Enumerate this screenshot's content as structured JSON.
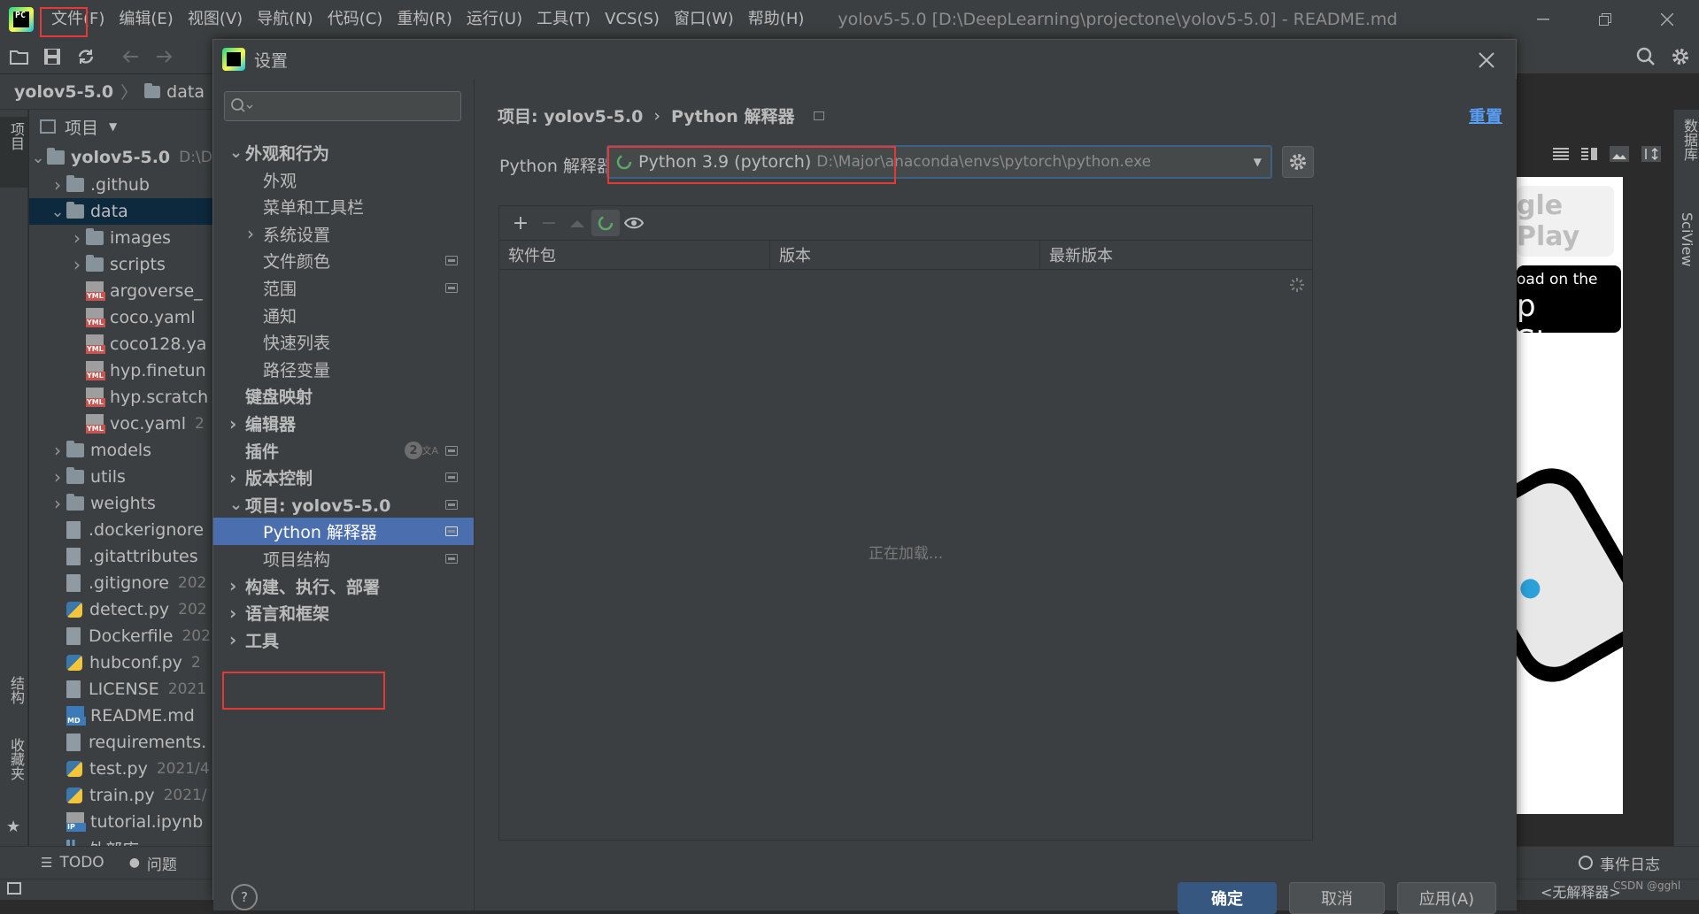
{
  "app": {
    "window_title": "yolov5-5.0 [D:\\DeepLearning\\projectone\\yolov5-5.0] - README.md",
    "logo_text": "PC"
  },
  "menubar": {
    "items": [
      {
        "label": "文件(F)"
      },
      {
        "label": "编辑(E)"
      },
      {
        "label": "视图(V)"
      },
      {
        "label": "导航(N)"
      },
      {
        "label": "代码(C)"
      },
      {
        "label": "重构(R)"
      },
      {
        "label": "运行(U)"
      },
      {
        "label": "工具(T)"
      },
      {
        "label": "VCS(S)"
      },
      {
        "label": "窗口(W)"
      },
      {
        "label": "帮助(H)"
      }
    ]
  },
  "breadcrumb": {
    "project": "yolov5-5.0",
    "folder": "data"
  },
  "left_stripe": {
    "project_tab": "项目",
    "structure_tab": "结构",
    "favorites_tab": "收藏夹"
  },
  "right_stripe": {
    "database_tab": "数据库",
    "sciview_tab": "SciView"
  },
  "project_panel": {
    "title": "项目",
    "tree": [
      {
        "name": "yolov5-5.0",
        "extra": "D:\\D",
        "type": "folder",
        "expanded": true,
        "bold": true
      },
      {
        "name": ".github",
        "extra": "",
        "type": "folder"
      },
      {
        "name": "data",
        "extra": "",
        "type": "folder",
        "expanded": true,
        "selected": true
      },
      {
        "name": "images",
        "extra": "",
        "type": "folder"
      },
      {
        "name": "scripts",
        "extra": "",
        "type": "folder"
      },
      {
        "name": "argoverse_",
        "extra": "",
        "type": "yml"
      },
      {
        "name": "coco.yaml",
        "extra": "",
        "type": "yml"
      },
      {
        "name": "coco128.ya",
        "extra": "",
        "type": "yml"
      },
      {
        "name": "hyp.finetun",
        "extra": "",
        "type": "yml"
      },
      {
        "name": "hyp.scratch",
        "extra": "",
        "type": "yml"
      },
      {
        "name": "voc.yaml",
        "extra": "2",
        "type": "yml"
      },
      {
        "name": "models",
        "extra": "",
        "type": "folder"
      },
      {
        "name": "utils",
        "extra": "",
        "type": "folder"
      },
      {
        "name": "weights",
        "extra": "",
        "type": "folder"
      },
      {
        "name": ".dockerignore",
        "extra": "",
        "type": "file"
      },
      {
        "name": ".gitattributes",
        "extra": "",
        "type": "file"
      },
      {
        "name": ".gitignore",
        "extra": "202",
        "type": "file"
      },
      {
        "name": "detect.py",
        "extra": "202",
        "type": "py"
      },
      {
        "name": "Dockerfile",
        "extra": "202",
        "type": "file"
      },
      {
        "name": "hubconf.py",
        "extra": "2",
        "type": "py"
      },
      {
        "name": "LICENSE",
        "extra": "2021",
        "type": "file"
      },
      {
        "name": "README.md",
        "extra": "",
        "type": "md"
      },
      {
        "name": "requirements.",
        "extra": "",
        "type": "file"
      },
      {
        "name": "test.py",
        "extra": "2021/4",
        "type": "py"
      },
      {
        "name": "train.py",
        "extra": "2021/",
        "type": "py"
      },
      {
        "name": "tutorial.ipynb",
        "extra": "",
        "type": "ipynb"
      },
      {
        "name": "外部库",
        "extra": "",
        "type": "lib"
      }
    ]
  },
  "bottom_bar": {
    "todo": "TODO",
    "problems": "问题",
    "event_log": "事件日志",
    "interpreter_status": "<无解释器>",
    "watermark": "CSDN @gghl"
  },
  "preview": {
    "google_play": "gle Play",
    "app_store_small": "oad on the",
    "app_store": "p Store"
  },
  "dialog": {
    "title": "设置",
    "search_placeholder": "",
    "nav": [
      {
        "label": "外观和行为",
        "level": 0,
        "bold": true,
        "arrow": "down"
      },
      {
        "label": "外观",
        "level": 1
      },
      {
        "label": "菜单和工具栏",
        "level": 1
      },
      {
        "label": "系统设置",
        "level": 1,
        "arrow": "right"
      },
      {
        "label": "文件颜色",
        "level": 1,
        "icon": true
      },
      {
        "label": "范围",
        "level": 1,
        "icon": true
      },
      {
        "label": "通知",
        "level": 1
      },
      {
        "label": "快速列表",
        "level": 1
      },
      {
        "label": "路径变量",
        "level": 1
      },
      {
        "label": "键盘映射",
        "level": 0,
        "bold": true
      },
      {
        "label": "编辑器",
        "level": 0,
        "bold": true,
        "arrow": "right"
      },
      {
        "label": "插件",
        "level": 0,
        "bold": true,
        "badge": "2",
        "icon": true
      },
      {
        "label": "版本控制",
        "level": 0,
        "bold": true,
        "arrow": "right",
        "icon": true
      },
      {
        "label": "项目: yolov5-5.0",
        "level": 0,
        "bold": true,
        "arrow": "down",
        "icon": true
      },
      {
        "label": "Python 解释器",
        "level": 1,
        "selected": true,
        "icon": true
      },
      {
        "label": "项目结构",
        "level": 1,
        "icon": true
      },
      {
        "label": "构建、执行、部署",
        "level": 0,
        "bold": true,
        "arrow": "right"
      },
      {
        "label": "语言和框架",
        "level": 0,
        "bold": true,
        "arrow": "right"
      },
      {
        "label": "工具",
        "level": 0,
        "bold": true,
        "arrow": "right"
      }
    ],
    "content": {
      "crumb_project": "项目: yolov5-5.0",
      "crumb_page": "Python 解释器",
      "reset": "重置",
      "interpreter_label": "Python 解释器:",
      "interpreter_name": "Python 3.9 (pytorch)",
      "interpreter_path": "D:\\Major\\anaconda\\envs\\pytorch\\python.exe",
      "columns": [
        "软件包",
        "版本",
        "最新版本"
      ],
      "loading": "正在加载..."
    },
    "footer": {
      "ok": "确定",
      "cancel": "取消",
      "apply": "应用(A)",
      "help": "?"
    }
  },
  "colors": {
    "accent": "#4b6eaf",
    "link": "#589df6",
    "highlight_box": "#e53935",
    "background": "#3c3f41"
  }
}
